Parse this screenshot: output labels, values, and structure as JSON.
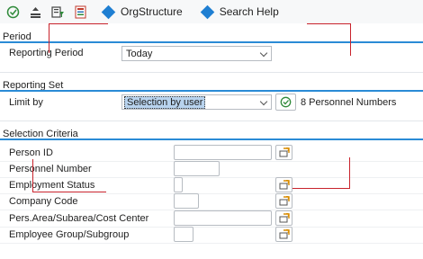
{
  "toolbar": {
    "icons": [
      "execute-icon",
      "variant-icon",
      "filter-icon",
      "list-icon"
    ],
    "orgstructure_label": "OrgStructure",
    "searchhelp_label": "Search Help"
  },
  "period": {
    "title": "Period",
    "reporting_period_label": "Reporting Period",
    "reporting_period_value": "Today"
  },
  "reporting_set": {
    "title": "Reporting Set",
    "limit_by_label": "Limit by",
    "limit_by_value": "Selection by user",
    "count_text": "8 Personnel Numbers"
  },
  "selection_criteria": {
    "title": "Selection Criteria",
    "fields": [
      {
        "label": "Person ID",
        "value": ""
      },
      {
        "label": "Personnel Number",
        "value": ""
      },
      {
        "label": "Employment Status",
        "value": ""
      },
      {
        "label": "Company Code",
        "value": ""
      },
      {
        "label": "Pers.Area/Subarea/Cost Center",
        "value": ""
      },
      {
        "label": "Employee Group/Subgroup",
        "value": ""
      }
    ]
  },
  "colors": {
    "accent": "#2a8bd6",
    "annotation": "#c8232c",
    "button_icon": "#1f7fd2"
  }
}
